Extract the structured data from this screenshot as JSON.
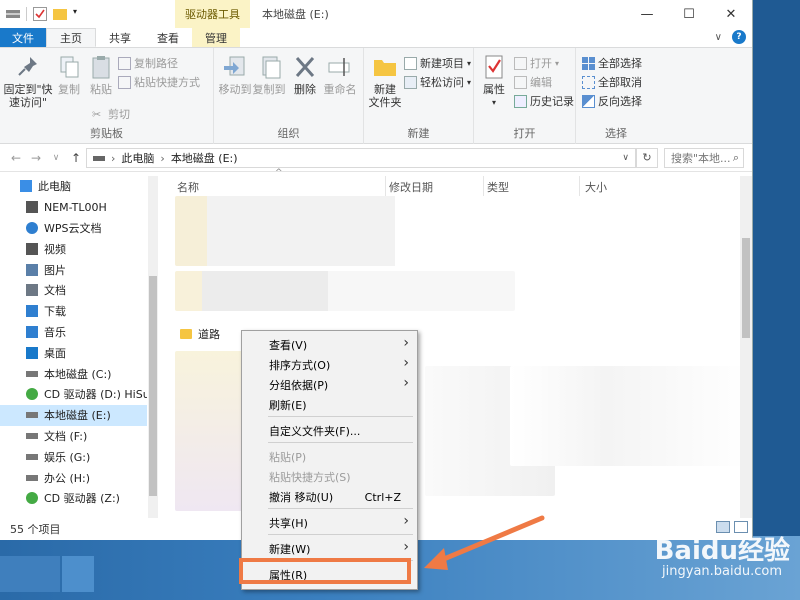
{
  "titlebar": {
    "context_tab": "驱动器工具",
    "window_title": "本地磁盘 (E:)",
    "minimize": "—",
    "maximize": "☐",
    "close": "✕"
  },
  "tabs": {
    "file": "文件",
    "home": "主页",
    "share": "共享",
    "view": "查看",
    "manage": "管理"
  },
  "ribbon": {
    "clipboard": {
      "label": "剪贴板",
      "pin": "固定到\"快\n速访问\"",
      "copy": "复制",
      "paste": "粘贴",
      "copy_path": "复制路径",
      "paste_shortcut": "粘贴快捷方式",
      "cut": "剪切"
    },
    "organize": {
      "label": "组织",
      "move_to": "移动到",
      "copy_to": "复制到",
      "delete": "删除",
      "rename": "重命名"
    },
    "new": {
      "label": "新建",
      "new_folder": "新建\n文件夹",
      "new_item": "新建项目",
      "easy_access": "轻松访问"
    },
    "open": {
      "label": "打开",
      "properties": "属性",
      "open": "打开",
      "edit": "编辑",
      "history": "历史记录"
    },
    "select": {
      "label": "选择",
      "select_all": "全部选择",
      "select_none": "全部取消",
      "invert": "反向选择"
    }
  },
  "address": {
    "pc": "此电脑",
    "drive": "本地磁盘 (E:)",
    "search_placeholder": "搜索\"本地..."
  },
  "nav": {
    "items": [
      {
        "label": "此电脑",
        "icon": "pc-icon"
      },
      {
        "label": "NEM-TL00H",
        "icon": "device-icon"
      },
      {
        "label": "WPS云文档",
        "icon": "cloud-icon"
      },
      {
        "label": "视频",
        "icon": "video-icon"
      },
      {
        "label": "图片",
        "icon": "picture-icon"
      },
      {
        "label": "文档",
        "icon": "document-icon"
      },
      {
        "label": "下载",
        "icon": "download-icon"
      },
      {
        "label": "音乐",
        "icon": "music-icon"
      },
      {
        "label": "桌面",
        "icon": "desktop-icon"
      },
      {
        "label": "本地磁盘 (C:)",
        "icon": "drive-icon"
      },
      {
        "label": "CD 驱动器 (D:) HiSuite",
        "icon": "cd-icon"
      },
      {
        "label": "本地磁盘 (E:)",
        "icon": "drive-icon"
      },
      {
        "label": "文档 (F:)",
        "icon": "drive-icon"
      },
      {
        "label": "娱乐 (G:)",
        "icon": "drive-icon"
      },
      {
        "label": "办公 (H:)",
        "icon": "drive-icon"
      },
      {
        "label": "CD 驱动器 (Z:)",
        "icon": "cd-icon"
      }
    ],
    "selected_index": 11
  },
  "status": {
    "count": "55 个项目"
  },
  "columns": {
    "name": "名称",
    "modified": "修改日期",
    "type": "类型",
    "size": "大小"
  },
  "visible_file": {
    "name": "道路"
  },
  "context_menu": {
    "items": [
      {
        "label": "查看(V)",
        "submenu": true
      },
      {
        "label": "排序方式(O)",
        "submenu": true
      },
      {
        "label": "分组依据(P)",
        "submenu": true
      },
      {
        "label": "刷新(E)"
      },
      {
        "label": "自定义文件夹(F)..."
      },
      {
        "label": "粘贴(P)",
        "disabled": true
      },
      {
        "label": "粘贴快捷方式(S)",
        "disabled": true
      },
      {
        "label": "撤消 移动(U)",
        "shortcut": "Ctrl+Z"
      },
      {
        "label": "共享(H)",
        "submenu": true
      },
      {
        "label": "新建(W)",
        "submenu": true
      },
      {
        "label": "属性(R)"
      }
    ]
  },
  "watermark": {
    "brand": "Baidu经验",
    "url": "jingyan.baidu.com"
  },
  "colors": {
    "accent": "#1979ca",
    "highlight": "#ef7a45",
    "selection": "#cce8ff",
    "context_tab": "#fbf3c6"
  }
}
